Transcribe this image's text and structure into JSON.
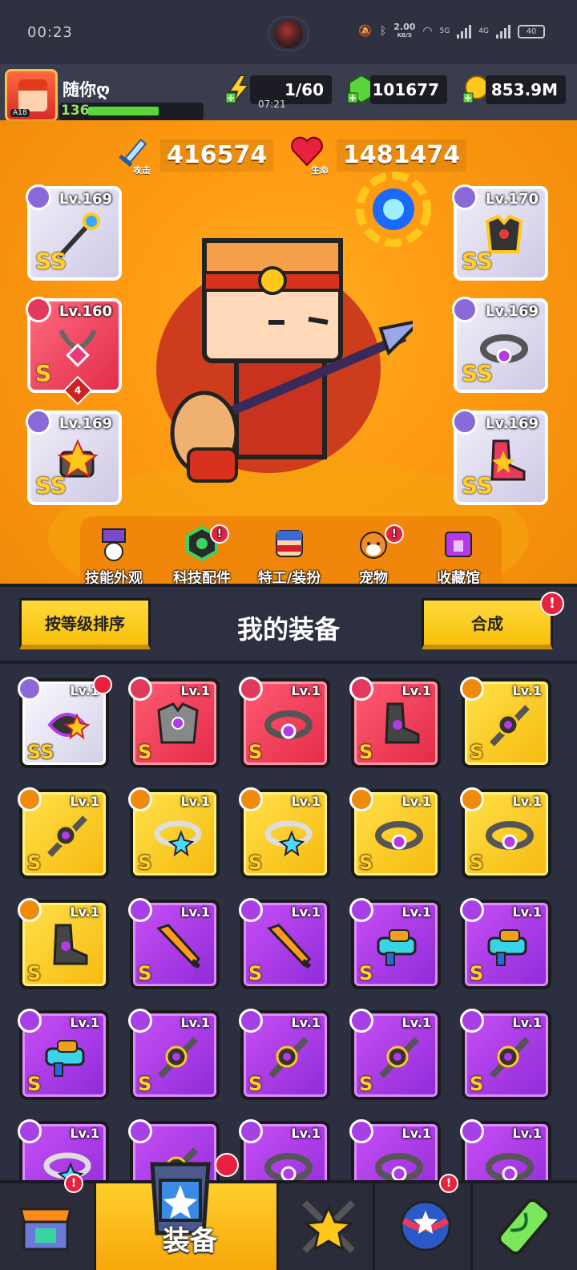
{
  "status": {
    "time": "00:23",
    "speed": "2.00",
    "speed_unit": "KB/S",
    "net1": "5G",
    "net2": "4G",
    "battery": "40"
  },
  "player": {
    "name": "随你ღ",
    "level": "136",
    "avatar_level": "A18"
  },
  "resources": {
    "energy": "1/60",
    "energy_timer": "07:21",
    "gems": "101677",
    "gold": "853.9M"
  },
  "stats": {
    "attack_value": "416574",
    "attack_label": "攻击",
    "hp_value": "1481474",
    "hp_label": "生命"
  },
  "equipped": {
    "left": [
      {
        "level": "Lv.169",
        "grade": "SS"
      },
      {
        "level": "Lv.160",
        "grade": "S",
        "stars": "4"
      },
      {
        "level": "Lv.169",
        "grade": "SS"
      }
    ],
    "right": [
      {
        "level": "Lv.170",
        "grade": "SS"
      },
      {
        "level": "Lv.169",
        "grade": "SS"
      },
      {
        "level": "Lv.169",
        "grade": "SS"
      }
    ]
  },
  "menu": [
    {
      "label": "技能外观",
      "alert": false
    },
    {
      "label": "科技配件",
      "alert": true
    },
    {
      "label": "特工/装扮",
      "alert": false
    },
    {
      "label": "宠物",
      "alert": true
    },
    {
      "label": "收藏馆",
      "alert": false
    }
  ],
  "inventory": {
    "sort_button": "按等级排序",
    "title": "我的装备",
    "merge_button": "合成",
    "alert_mark": "!",
    "items": [
      {
        "rarity": "white",
        "level": "Lv.1",
        "grade": "SS"
      },
      {
        "rarity": "red",
        "level": "Lv.1",
        "grade": "S"
      },
      {
        "rarity": "red",
        "level": "Lv.1",
        "grade": "S"
      },
      {
        "rarity": "red",
        "level": "Lv.1",
        "grade": "S"
      },
      {
        "rarity": "yellow",
        "level": "Lv.1",
        "grade": "S"
      },
      {
        "rarity": "yellow",
        "level": "Lv.1",
        "grade": "S"
      },
      {
        "rarity": "yellow",
        "level": "Lv.1",
        "grade": "S"
      },
      {
        "rarity": "yellow",
        "level": "Lv.1",
        "grade": "S"
      },
      {
        "rarity": "yellow",
        "level": "Lv.1",
        "grade": "S"
      },
      {
        "rarity": "yellow",
        "level": "Lv.1",
        "grade": "S"
      },
      {
        "rarity": "yellow",
        "level": "Lv.1",
        "grade": "S"
      },
      {
        "rarity": "purple",
        "level": "Lv.1",
        "grade": "S"
      },
      {
        "rarity": "purple",
        "level": "Lv.1",
        "grade": "S"
      },
      {
        "rarity": "purple",
        "level": "Lv.1",
        "grade": "S"
      },
      {
        "rarity": "purple",
        "level": "Lv.1",
        "grade": "S"
      },
      {
        "rarity": "purple",
        "level": "Lv.1",
        "grade": "S"
      },
      {
        "rarity": "purple",
        "level": "Lv.1",
        "grade": "S"
      },
      {
        "rarity": "purple",
        "level": "Lv.1",
        "grade": "S"
      },
      {
        "rarity": "purple",
        "level": "Lv.1",
        "grade": "S"
      },
      {
        "rarity": "purple",
        "level": "Lv.1",
        "grade": "S"
      },
      {
        "rarity": "purple",
        "level": "Lv.1",
        "grade": ""
      },
      {
        "rarity": "purple",
        "level": "",
        "grade": ""
      },
      {
        "rarity": "purple",
        "level": "Lv.1",
        "grade": ""
      },
      {
        "rarity": "purple",
        "level": "Lv.1",
        "grade": ""
      },
      {
        "rarity": "purple",
        "level": "Lv.1",
        "grade": ""
      }
    ]
  },
  "nav": {
    "active_label": "装备"
  }
}
